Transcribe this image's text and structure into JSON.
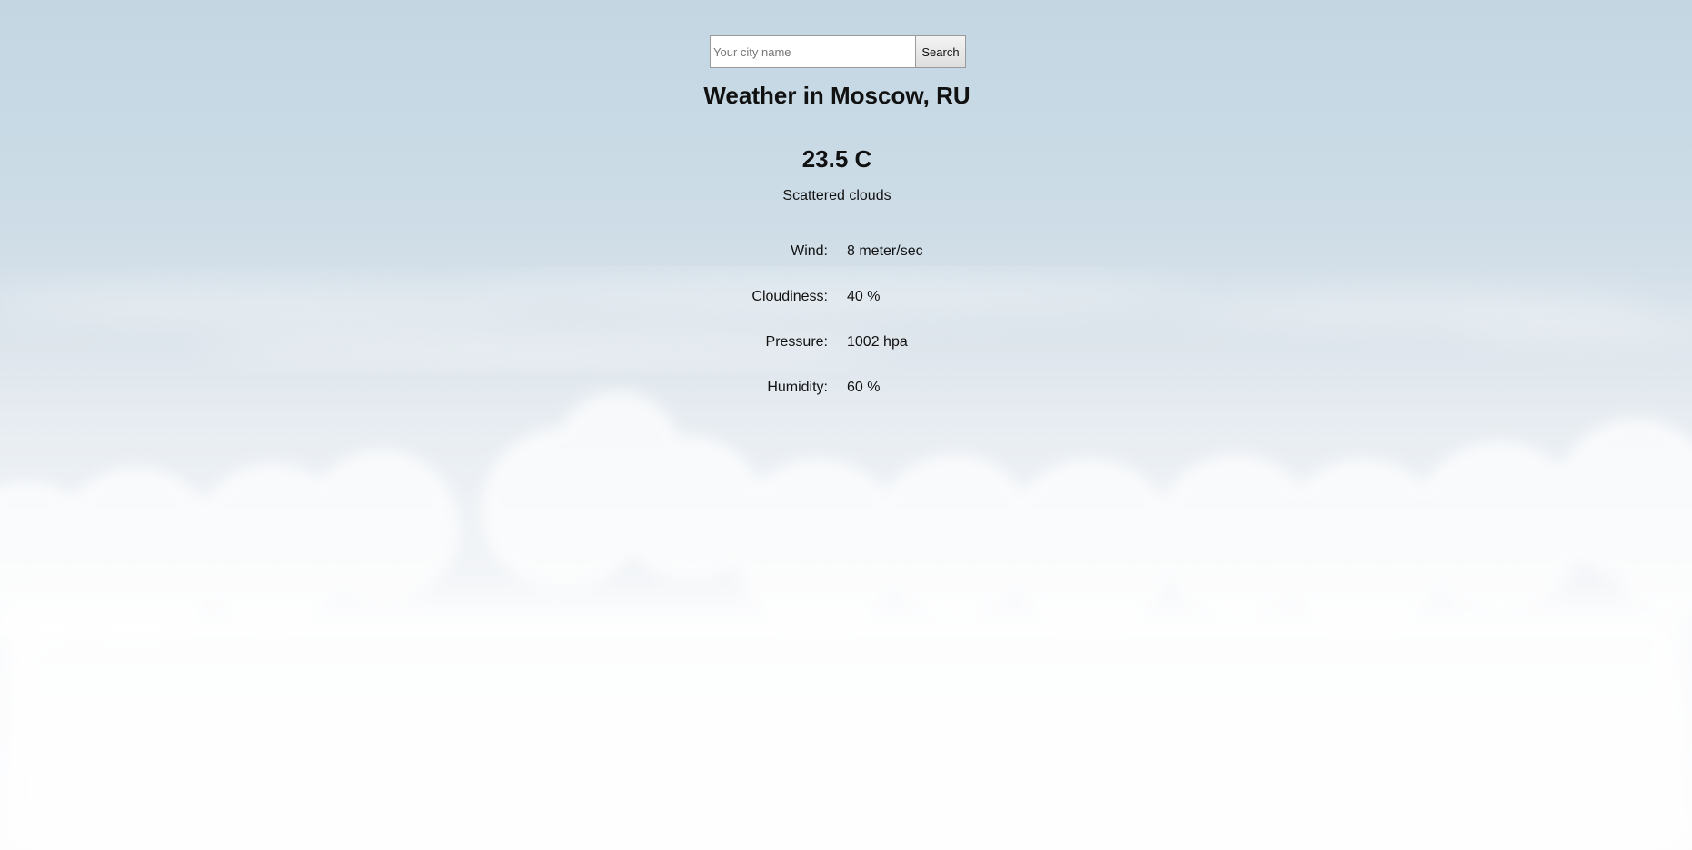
{
  "search": {
    "placeholder": "Your city name",
    "value": "",
    "button_label": "Search"
  },
  "weather": {
    "title": "Weather in Moscow, RU",
    "temperature": "23.5 C",
    "description": "Scattered clouds"
  },
  "details": [
    {
      "label": "Wind:",
      "value": "8 meter/sec"
    },
    {
      "label": "Cloudiness:",
      "value": "40 %"
    },
    {
      "label": "Pressure:",
      "value": "1002 hpa"
    },
    {
      "label": "Humidity:",
      "value": "60 %"
    }
  ],
  "colors": {
    "sky_top": "#c3d6e2",
    "sky_bottom": "#fcfcfd",
    "text": "#111111"
  }
}
